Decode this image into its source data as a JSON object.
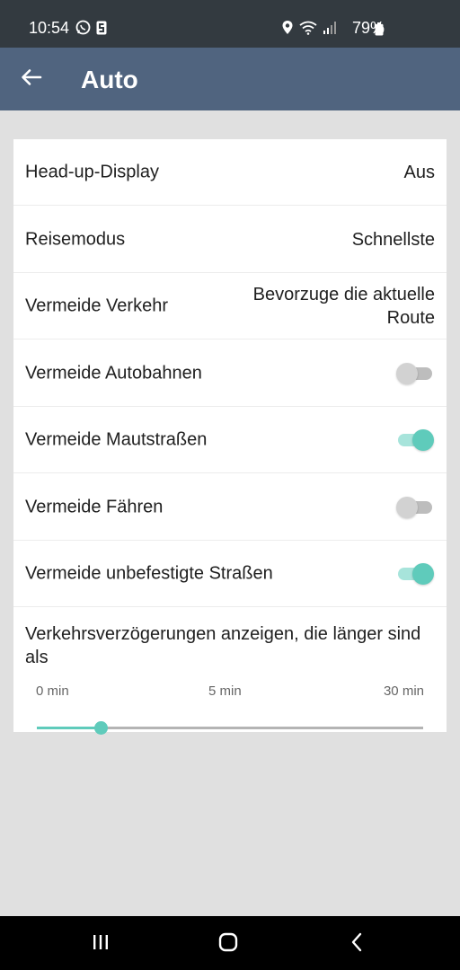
{
  "status_bar": {
    "time": "10:54",
    "battery": "79%",
    "icons": [
      "whatsapp-icon",
      "s-app-icon",
      "location-icon",
      "wifi-icon",
      "signal-icon",
      "battery-icon"
    ]
  },
  "app_bar": {
    "title": "Auto",
    "back_icon": "arrow-left-icon",
    "color": "#50647f"
  },
  "settings": [
    {
      "label": "Head-up-Display",
      "value": "Aus"
    },
    {
      "label": "Reisemodus",
      "value": "Schnellste"
    },
    {
      "label": "Vermeide Verkehr",
      "value": "Bevorzuge die aktuelle Route"
    },
    {
      "label": "Vermeide Autobahnen",
      "toggle": false
    },
    {
      "label": "Vermeide Mautstraßen",
      "toggle": true
    },
    {
      "label": "Vermeide Fähren",
      "toggle": false
    },
    {
      "label": "Vermeide unbefestigte Straßen",
      "toggle": true
    }
  ],
  "delay_slider": {
    "label": "Verkehrsverzögerungen anzeigen, die länger sind als",
    "ticks": [
      "0 min",
      "5 min",
      "30 min"
    ],
    "position_fraction": 0.165
  },
  "accent_color": "#5fcbbb",
  "nav_bar": {
    "icons": [
      "recent-apps-icon",
      "home-icon",
      "back-icon"
    ]
  }
}
